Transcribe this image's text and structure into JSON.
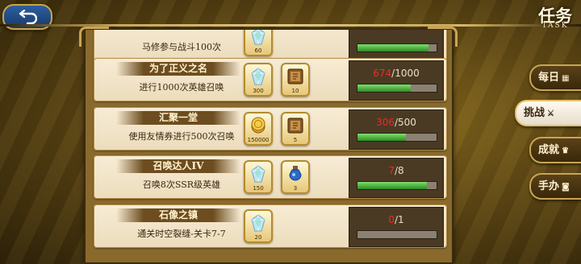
{
  "header": {
    "title": "任务",
    "subtitle": "TASK"
  },
  "tabs": [
    {
      "label": "每日",
      "icon": "calendar-icon",
      "active": false
    },
    {
      "label": "挑战",
      "icon": "crossed-swords-icon",
      "active": true
    },
    {
      "label": "成就",
      "icon": "trophy-icon",
      "active": false
    },
    {
      "label": "手办",
      "icon": "figure-icon",
      "active": false
    }
  ],
  "quests": [
    {
      "name": "",
      "description": "马修参与战斗100次",
      "rewards": [
        {
          "icon": "crystal-icon",
          "qty": "60"
        }
      ],
      "progress_current": "",
      "progress_total": "",
      "progress_fraction": 0.9
    },
    {
      "name": "为了正义之名",
      "description": "进行1000次英雄召唤",
      "rewards": [
        {
          "icon": "crystal-icon",
          "qty": "300"
        },
        {
          "icon": "ticket-icon",
          "qty": "10"
        }
      ],
      "progress_current": "674",
      "progress_total": "/1000",
      "progress_fraction": 0.674
    },
    {
      "name": "汇聚一堂",
      "description": "使用友情券进行500次召唤",
      "rewards": [
        {
          "icon": "coin-icon",
          "qty": "150000"
        },
        {
          "icon": "ticket-icon",
          "qty": "5"
        }
      ],
      "progress_current": "306",
      "progress_total": "/500",
      "progress_fraction": 0.612
    },
    {
      "name": "召唤达人IV",
      "description": "召唤8次SSR级英雄",
      "rewards": [
        {
          "icon": "crystal-icon",
          "qty": "150"
        },
        {
          "icon": "potion-icon",
          "qty": "3"
        }
      ],
      "progress_current": "7",
      "progress_total": "/8",
      "progress_fraction": 0.875
    },
    {
      "name": "石像之镇",
      "description": "通关时空裂缝-关卡7-7",
      "rewards": [
        {
          "icon": "crystal-icon",
          "qty": "20"
        }
      ],
      "progress_current": "0",
      "progress_total": "/1",
      "progress_fraction": 0
    }
  ],
  "colors": {
    "progress_red": "#ee2b24",
    "bar_green": "#3fa531",
    "gold": "#c9a553"
  }
}
